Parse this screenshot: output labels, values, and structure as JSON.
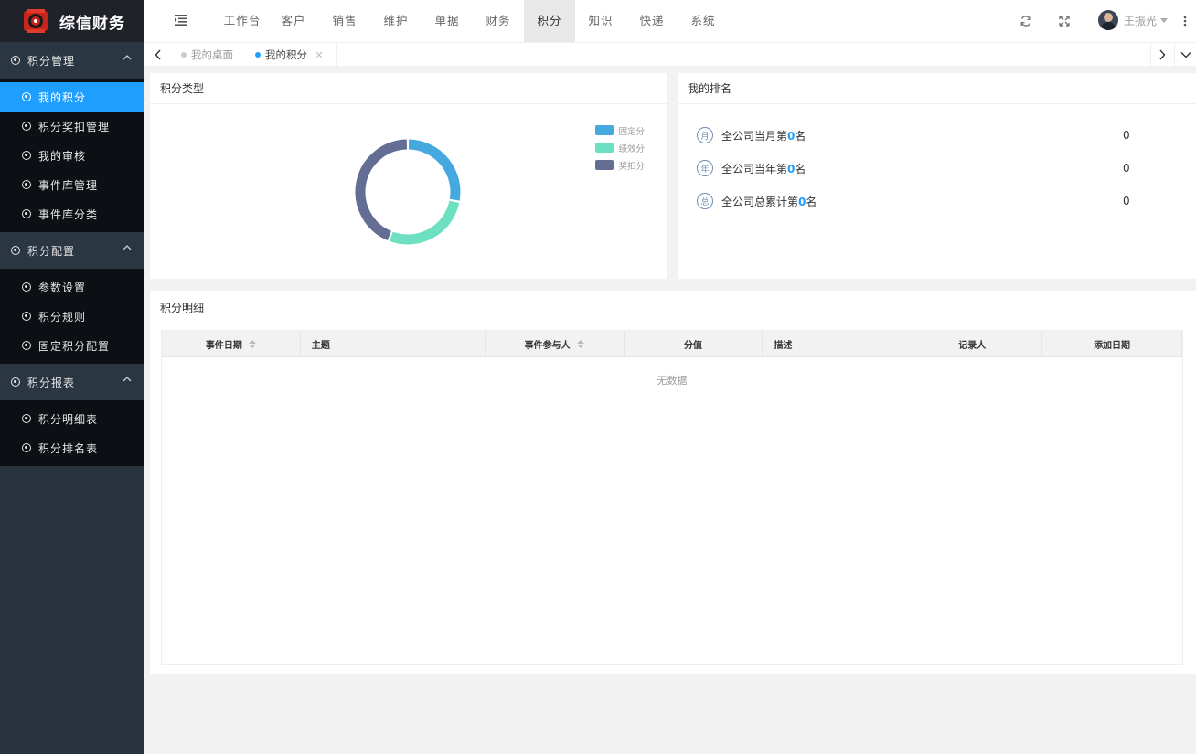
{
  "brand": {
    "name": "综信财务"
  },
  "sidebar": {
    "groups": [
      {
        "title": "积分管理",
        "items": [
          {
            "label": "我的积分",
            "active": true
          },
          {
            "label": "积分奖扣管理"
          },
          {
            "label": "我的审核"
          },
          {
            "label": "事件库管理"
          },
          {
            "label": "事件库分类"
          }
        ]
      },
      {
        "title": "积分配置",
        "items": [
          {
            "label": "参数设置"
          },
          {
            "label": "积分规则"
          },
          {
            "label": "固定积分配置"
          }
        ]
      },
      {
        "title": "积分报表",
        "items": [
          {
            "label": "积分明细表"
          },
          {
            "label": "积分排名表"
          }
        ]
      }
    ]
  },
  "header": {
    "nav": [
      "工作台",
      "客户",
      "销售",
      "维护",
      "单据",
      "财务",
      "积分",
      "知识",
      "快递",
      "系统"
    ],
    "active_nav": "积分",
    "user": "王振光",
    "icons": [
      "refresh-icon",
      "fullscreen-icon",
      "more-icon"
    ]
  },
  "tabs": [
    {
      "label": "我的桌面"
    },
    {
      "label": "我的积分",
      "active": true,
      "close": "×"
    }
  ],
  "score_type": {
    "title": "积分类型",
    "legend": [
      {
        "name": "固定分",
        "color": "#45a8de"
      },
      {
        "name": "绩效分",
        "color": "#6de0c2"
      },
      {
        "name": "奖扣分",
        "color": "#646e94"
      }
    ]
  },
  "ranking": {
    "title": "我的排名",
    "rows": [
      {
        "badge": "月",
        "prefix": "全公司当月第",
        "rank": "0",
        "suffix": "名",
        "value": "0"
      },
      {
        "badge": "年",
        "prefix": "全公司当年第",
        "rank": "0",
        "suffix": "名",
        "value": "0"
      },
      {
        "badge": "总",
        "prefix": "全公司总累计第",
        "rank": "0",
        "suffix": "名",
        "value": "0"
      }
    ]
  },
  "detail": {
    "title": "积分明细",
    "columns": [
      {
        "label": "事件日期",
        "sortable": true
      },
      {
        "label": "主题"
      },
      {
        "label": "事件参与人",
        "sortable": true
      },
      {
        "label": "分值"
      },
      {
        "label": "描述"
      },
      {
        "label": "记录人"
      },
      {
        "label": "添加日期"
      }
    ],
    "empty_text": "无数据"
  },
  "colors": {
    "accent": "#1e9fff",
    "sidebar": "#28333e",
    "submenu": "#0c0f13"
  },
  "chart_data": {
    "type": "pie",
    "title": "",
    "categories": [
      "固定分",
      "绩效分",
      "奖扣分"
    ],
    "values": [
      28,
      28,
      44
    ],
    "colors": [
      "#45a8de",
      "#6de0c2",
      "#646e94"
    ],
    "donut": true,
    "legend": "top-right"
  }
}
